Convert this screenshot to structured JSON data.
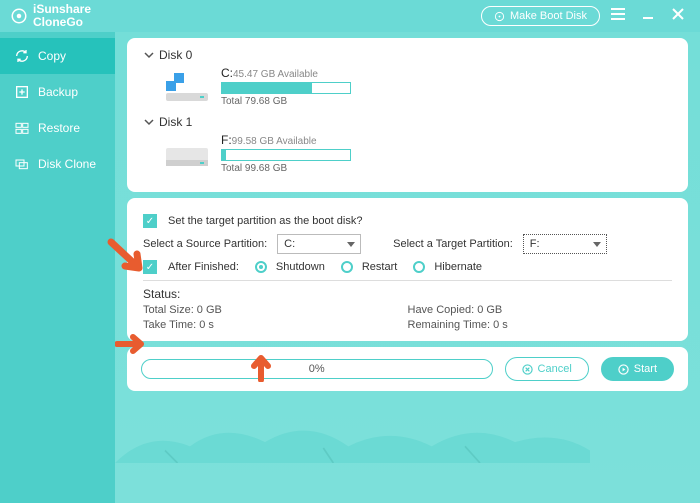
{
  "app": {
    "name1": "iSunshare",
    "name2": "CloneGo",
    "make_boot": "Make Boot Disk"
  },
  "sidebar": {
    "items": [
      {
        "label": "Copy"
      },
      {
        "label": "Backup"
      },
      {
        "label": "Restore"
      },
      {
        "label": "Disk Clone"
      }
    ]
  },
  "disks": [
    {
      "header": "Disk 0",
      "letter": "C:",
      "available": "45.47 GB Available",
      "total": "Total 79.68 GB",
      "fill_pct": 70
    },
    {
      "header": "Disk 1",
      "letter": "F:",
      "available": "99.58 GB Available",
      "total": "Total 99.68 GB",
      "fill_pct": 3
    }
  ],
  "options": {
    "set_boot_label": "Set the target partition as the boot disk?",
    "source_label": "Select a Source Partition:",
    "source_value": "C:",
    "target_label": "Select a Target Partition:",
    "target_value": "F:",
    "after_label": "After Finished:",
    "radios": {
      "shutdown": "Shutdown",
      "restart": "Restart",
      "hibernate": "Hibernate"
    }
  },
  "status": {
    "title": "Status:",
    "total_size": "Total Size: 0 GB",
    "have_copied": "Have Copied: 0 GB",
    "take_time": "Take Time: 0 s",
    "remaining": "Remaining Time: 0 s"
  },
  "footer": {
    "progress_text": "0%",
    "cancel": "Cancel",
    "start": "Start"
  },
  "colors": {
    "accent": "#4ecfc9",
    "arrow": "#e85c2f"
  }
}
